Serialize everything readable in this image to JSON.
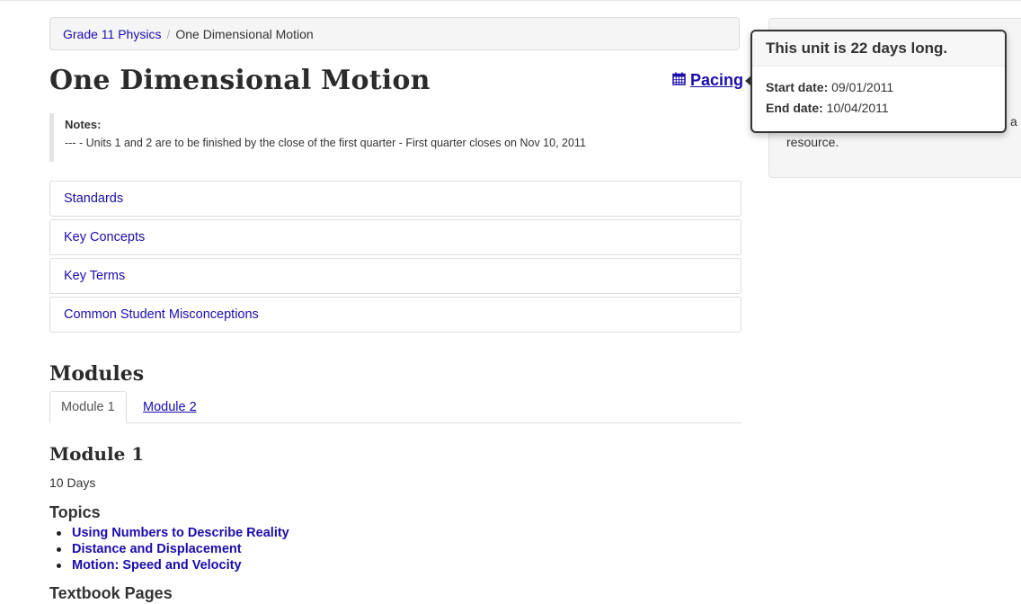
{
  "breadcrumb": {
    "parent": "Grade 11 Physics",
    "separator": "/",
    "current": "One Dimensional Motion"
  },
  "page_title": "One Dimensional Motion",
  "pacing": {
    "label": "Pacing",
    "icon": "calendar-icon"
  },
  "notes": {
    "label": "Notes:",
    "text": "--- - Units 1 and 2 are to be finished by the close of the first quarter - First quarter closes on Nov 10, 2011"
  },
  "accordion": [
    "Standards",
    "Key Concepts",
    "Key Terms",
    "Common Student Misconceptions"
  ],
  "modules": {
    "heading": "Modules",
    "tabs": [
      "Module 1",
      "Module 2"
    ],
    "active_title": "Module 1",
    "duration": "10 Days",
    "topics_heading": "Topics",
    "topics": [
      "Using Numbers to Describe Reality",
      "Distance and Displacement",
      "Motion: Speed and Velocity"
    ],
    "textbook_heading": "Textbook Pages"
  },
  "side_panel": {
    "tail_text": "a",
    "resource_text": "resource."
  },
  "popover": {
    "title": "This unit is 22 days long.",
    "start_label": "Start date:",
    "start_value": "09/01/2011",
    "end_label": "End date:",
    "end_value": "10/04/2011"
  },
  "colors": {
    "link": "#1a0dab",
    "text": "#333333",
    "border": "#dddddd"
  }
}
